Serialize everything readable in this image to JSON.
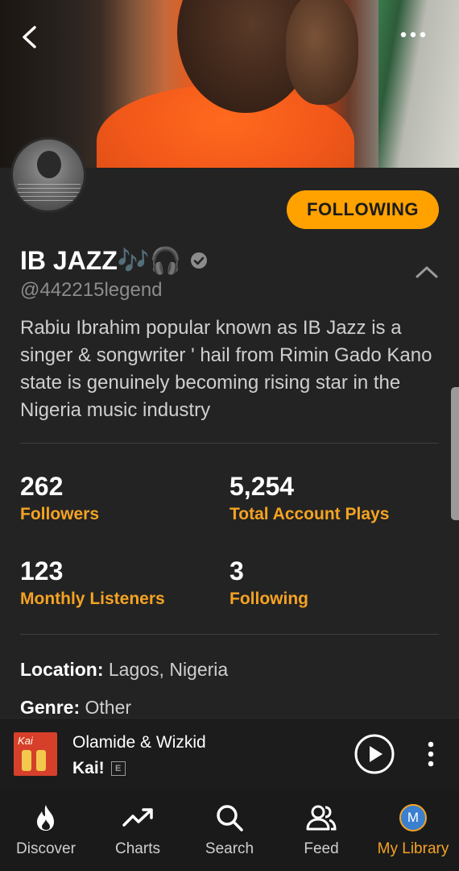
{
  "header": {
    "follow_button_label": "FOLLOWING"
  },
  "profile": {
    "name": "IB JAZZ🎶🎧",
    "handle": "@442215legend",
    "bio": "Rabiu Ibrahim popular known as IB Jazz is a singer & songwriter ' hail from Rimin Gado Kano state is genuinely becoming rising star in the Nigeria music industry",
    "verified": true
  },
  "stats": [
    {
      "value": "262",
      "label": "Followers"
    },
    {
      "value": "5,254",
      "label": "Total Account Plays"
    },
    {
      "value": "123",
      "label": "Monthly Listeners"
    },
    {
      "value": "3",
      "label": "Following"
    }
  ],
  "details": {
    "location_label": "Location:",
    "location_value": "Lagos, Nigeria",
    "genre_label": "Genre:",
    "genre_value": "Other"
  },
  "player": {
    "artist": "Olamide & Wizkid",
    "title": "Kai!",
    "explicit": "E",
    "cover_text": "Kai"
  },
  "tabs": [
    {
      "label": "Discover",
      "icon": "flame-icon"
    },
    {
      "label": "Charts",
      "icon": "trending-icon"
    },
    {
      "label": "Search",
      "icon": "search-icon"
    },
    {
      "label": "Feed",
      "icon": "people-icon"
    },
    {
      "label": "My Library",
      "icon": "avatar-icon",
      "avatar_letter": "M",
      "active": true
    }
  ],
  "colors": {
    "accent": "#ffa200",
    "label_orange": "#f5a323",
    "background": "#232323"
  }
}
